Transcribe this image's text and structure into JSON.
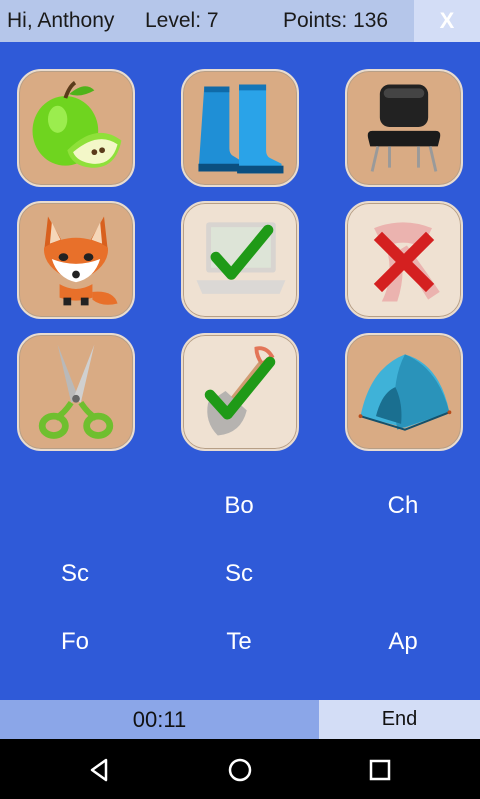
{
  "header": {
    "greeting": "Hi, Anthony",
    "level": "Level: 7",
    "points": "Points: 136",
    "close_label": "X"
  },
  "tiles": [
    {
      "name": "apple",
      "status": "normal"
    },
    {
      "name": "boots",
      "status": "normal"
    },
    {
      "name": "chair",
      "status": "normal"
    },
    {
      "name": "fox",
      "status": "normal"
    },
    {
      "name": "laptop",
      "status": "correct"
    },
    {
      "name": "scarf",
      "status": "wrong"
    },
    {
      "name": "scissors",
      "status": "normal"
    },
    {
      "name": "shovel",
      "status": "correct"
    },
    {
      "name": "tent",
      "status": "normal"
    }
  ],
  "words": [
    {
      "row": 1,
      "col": 2,
      "label": "Bo"
    },
    {
      "row": 1,
      "col": 3,
      "label": "Ch"
    },
    {
      "row": 2,
      "col": 1,
      "label": "Sc"
    },
    {
      "row": 2,
      "col": 2,
      "label": "Sc"
    },
    {
      "row": 3,
      "col": 1,
      "label": "Fo"
    },
    {
      "row": 3,
      "col": 2,
      "label": "Te"
    },
    {
      "row": 3,
      "col": 3,
      "label": "Ap"
    }
  ],
  "footer": {
    "timer": "00:11",
    "end_label": "End"
  },
  "colors": {
    "board": "#2f5ad8",
    "tile": "#d9ab84",
    "tile_done": "#efe1d2",
    "correct": "#1f9a17",
    "wrong": "#d42020"
  }
}
